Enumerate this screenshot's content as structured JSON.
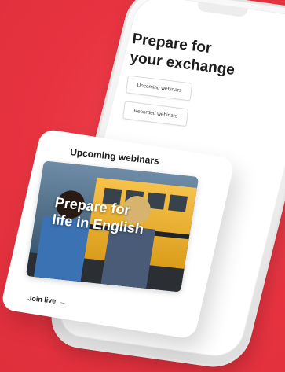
{
  "colors": {
    "background": "#e73340",
    "phone": "#f2f2f2",
    "card": "#ffffff",
    "text": "#1c1c1c"
  },
  "phone": {
    "title_line1": "Prepare for",
    "title_line2": "your exchange",
    "buttons": [
      {
        "label": "Upcoming webinars"
      },
      {
        "label": "Recorded webinars"
      }
    ]
  },
  "card": {
    "title": "Upcoming webinars",
    "photo_caption_line1": "Prepare for",
    "photo_caption_line2": "life in English",
    "join_label": "Join live",
    "join_icon": "arrow-right-icon"
  }
}
